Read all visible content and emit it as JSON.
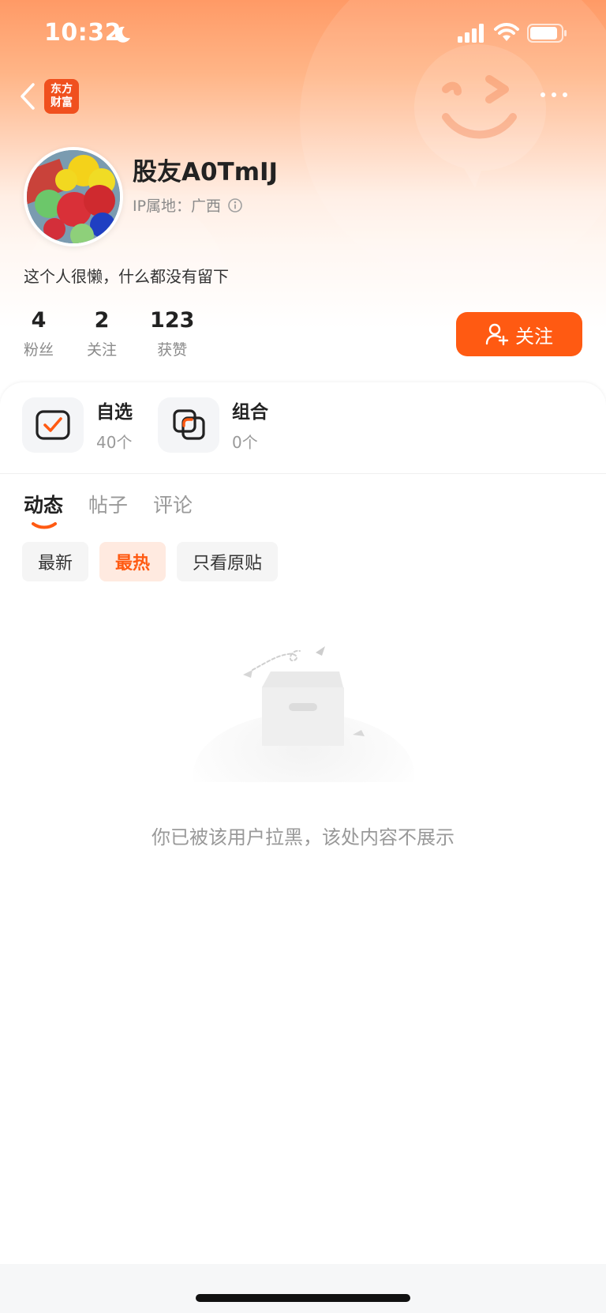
{
  "status_bar": {
    "time": "10:32"
  },
  "app": {
    "logo_line1": "东方",
    "logo_line2": "财富"
  },
  "profile": {
    "username": "股友A0TmIJ",
    "ip_location": "IP属地：广西",
    "bio": "这个人很懒，什么都没有留下",
    "stats": [
      {
        "value": "4",
        "label": "粉丝"
      },
      {
        "value": "2",
        "label": "关注"
      },
      {
        "value": "123",
        "label": "获赞"
      }
    ],
    "follow_label": "关注"
  },
  "features": [
    {
      "title": "自选",
      "count": "40个"
    },
    {
      "title": "组合",
      "count": "0个"
    }
  ],
  "tabs": [
    {
      "label": "动态",
      "active": true
    },
    {
      "label": "帖子",
      "active": false
    },
    {
      "label": "评论",
      "active": false
    }
  ],
  "filters": [
    {
      "label": "最新",
      "active": false
    },
    {
      "label": "最热",
      "active": true
    },
    {
      "label": "只看原贴",
      "active": false
    }
  ],
  "empty_state": {
    "message": "你已被该用户拉黑，该处内容不展示"
  },
  "colors": {
    "accent": "#ff5a12",
    "header_gradient_top": "#ff9a66"
  },
  "icons": {
    "back": "chevron-left-icon",
    "more": "more-horizontal-icon",
    "follow": "user-add-icon",
    "watchlist": "check-square-icon",
    "portfolio": "stacked-squares-icon",
    "ip_info": "info-icon"
  }
}
